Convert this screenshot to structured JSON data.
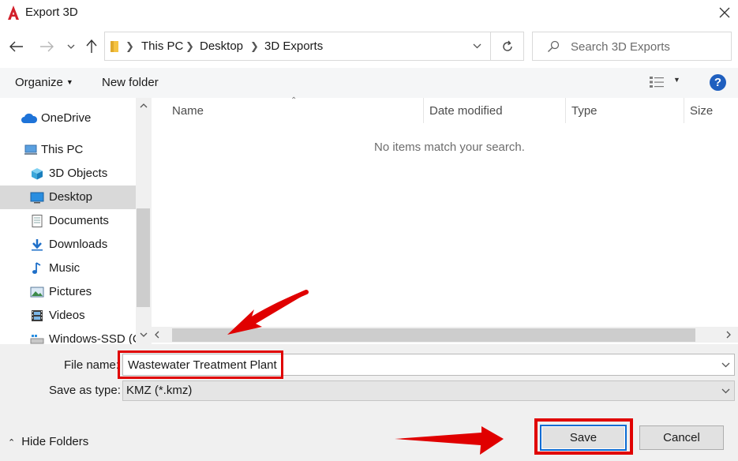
{
  "window": {
    "title": "Export 3D"
  },
  "address": {
    "crumbs": [
      "This PC",
      "Desktop",
      "3D Exports"
    ]
  },
  "search": {
    "placeholder": "Search 3D Exports"
  },
  "toolbar": {
    "organize_label": "Organize",
    "new_folder_label": "New folder",
    "help_label": "?"
  },
  "sidebar": {
    "items": [
      {
        "label": "OneDrive",
        "icon": "cloud-icon"
      },
      {
        "label": "This PC",
        "icon": "computer-icon"
      },
      {
        "label": "3D Objects",
        "icon": "cube-icon"
      },
      {
        "label": "Desktop",
        "icon": "desktop-icon",
        "selected": true
      },
      {
        "label": "Documents",
        "icon": "document-icon"
      },
      {
        "label": "Downloads",
        "icon": "download-arrow-icon"
      },
      {
        "label": "Music",
        "icon": "music-note-icon"
      },
      {
        "label": "Pictures",
        "icon": "picture-icon"
      },
      {
        "label": "Videos",
        "icon": "film-icon"
      },
      {
        "label": "Windows-SSD (C",
        "icon": "drive-icon"
      }
    ]
  },
  "filelist": {
    "columns": [
      "Name",
      "Date modified",
      "Type",
      "Size"
    ],
    "empty_message": "No items match your search."
  },
  "form": {
    "file_name_label": "File name:",
    "file_name_value": "Wastewater Treatment Plant",
    "save_as_type_label": "Save as type:",
    "save_as_type_value": "KMZ (*.kmz)"
  },
  "footer": {
    "hide_folders_label": "Hide Folders",
    "save_label": "Save",
    "cancel_label": "Cancel"
  },
  "colors": {
    "highlight": "#e00000",
    "accent": "#0b6bd3",
    "selected": "#d9d9d9"
  }
}
